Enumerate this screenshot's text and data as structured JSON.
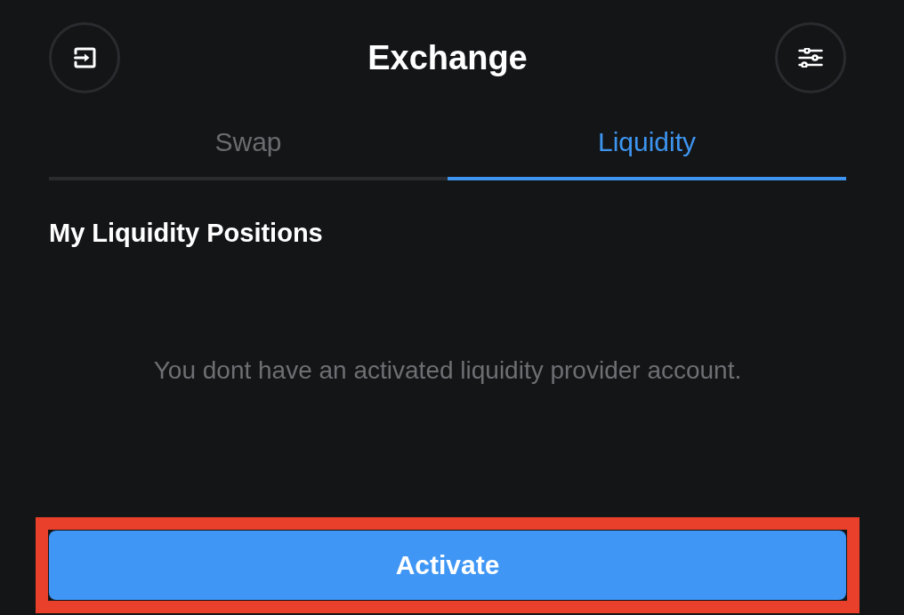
{
  "header": {
    "title": "Exchange"
  },
  "tabs": [
    {
      "label": "Swap",
      "selected": false
    },
    {
      "label": "Liquidity",
      "selected": true
    }
  ],
  "section": {
    "title": "My Liquidity Positions",
    "empty_message": "You dont have an activated liquidity provider account."
  },
  "primary_button": {
    "label": "Activate",
    "highlighted": true
  }
}
